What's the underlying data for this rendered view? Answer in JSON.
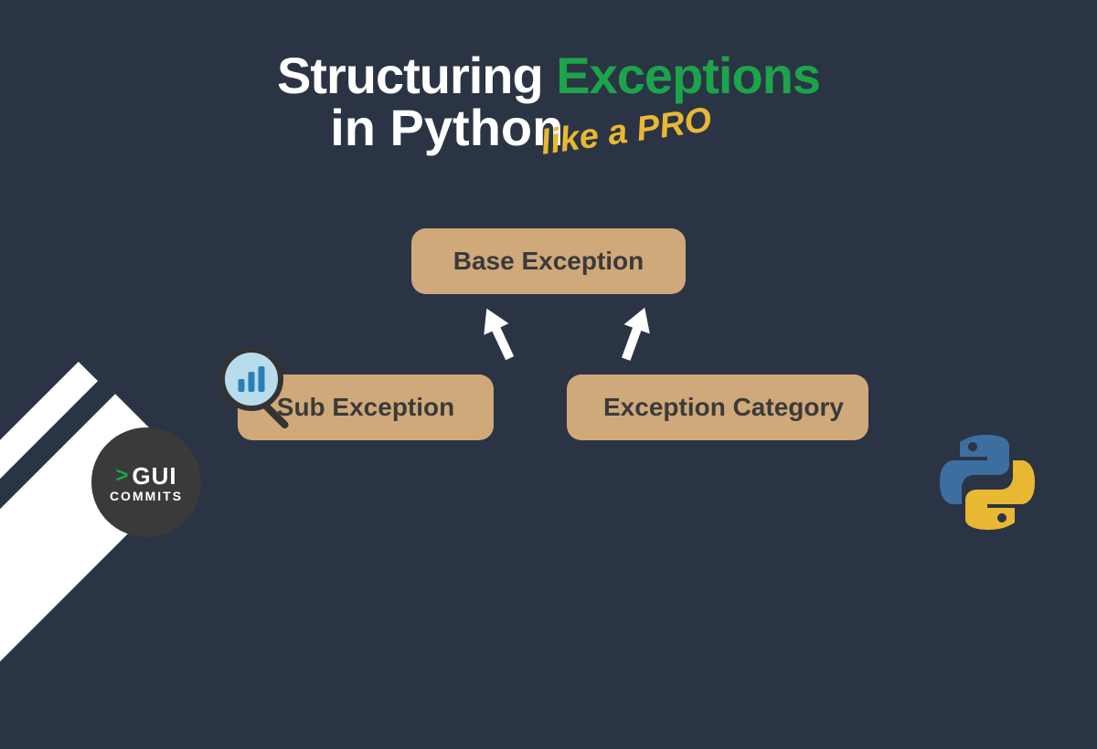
{
  "title": {
    "part1": "Structuring",
    "part2": "Exceptions",
    "line2": "in Python",
    "tag": "like a PRO"
  },
  "diagram": {
    "base": "Base Exception",
    "sub": "Sub Exception",
    "category": "Exception Category"
  },
  "badge": {
    "name": "GUI",
    "sub": "COMMITS"
  },
  "colors": {
    "bg": "#2b3444",
    "accent_green": "#1ca44a",
    "accent_yellow": "#e8b833",
    "box_bg": "#cfa97a"
  }
}
